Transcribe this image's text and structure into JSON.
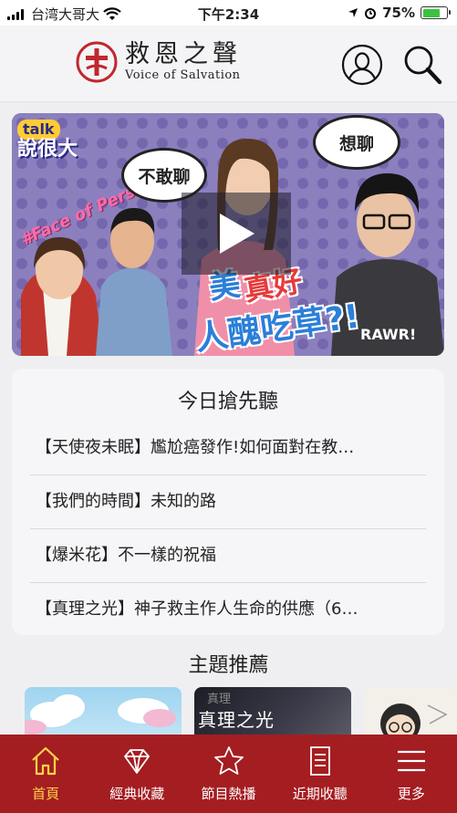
{
  "status_bar": {
    "carrier": "台湾大哥大",
    "time": "下午2:34",
    "battery": "75%",
    "battery_level": 0.75
  },
  "header": {
    "title_zh": "救恩之聲",
    "title_en": "Voice of Salvation"
  },
  "banner": {
    "brand_talk": "talk",
    "brand_main": "說很大",
    "side_text": "#Face of Personality",
    "bubble_left": "不敢聊",
    "bubble_right": "想聊",
    "title_line1": "美",
    "title_line1b": "真好",
    "title_line2": "人醜吃草?!"
  },
  "today": {
    "heading": "今日搶先聽",
    "items": [
      "【天使夜未眠】尷尬癌發作!如何面對在教…",
      "【我們的時間】未知的路",
      "【爆米花】不一樣的祝福",
      "【真理之光】神子救主作人生命的供應（6…"
    ]
  },
  "topics": {
    "heading": "主題推薦",
    "thumb2_small": "真理",
    "thumb2_text": "真理之光"
  },
  "tabbar": {
    "tabs": [
      {
        "label": "首頁",
        "icon": "home-icon"
      },
      {
        "label": "經典收藏",
        "icon": "diamond-icon"
      },
      {
        "label": "節目熱播",
        "icon": "star-icon"
      },
      {
        "label": "近期收聽",
        "icon": "list-document-icon"
      },
      {
        "label": "更多",
        "icon": "menu-icon"
      }
    ],
    "active_index": 0
  },
  "colors": {
    "brand_red": "#a41d21",
    "active_tab": "#ffd34a",
    "battery_green": "#3cc23c"
  }
}
